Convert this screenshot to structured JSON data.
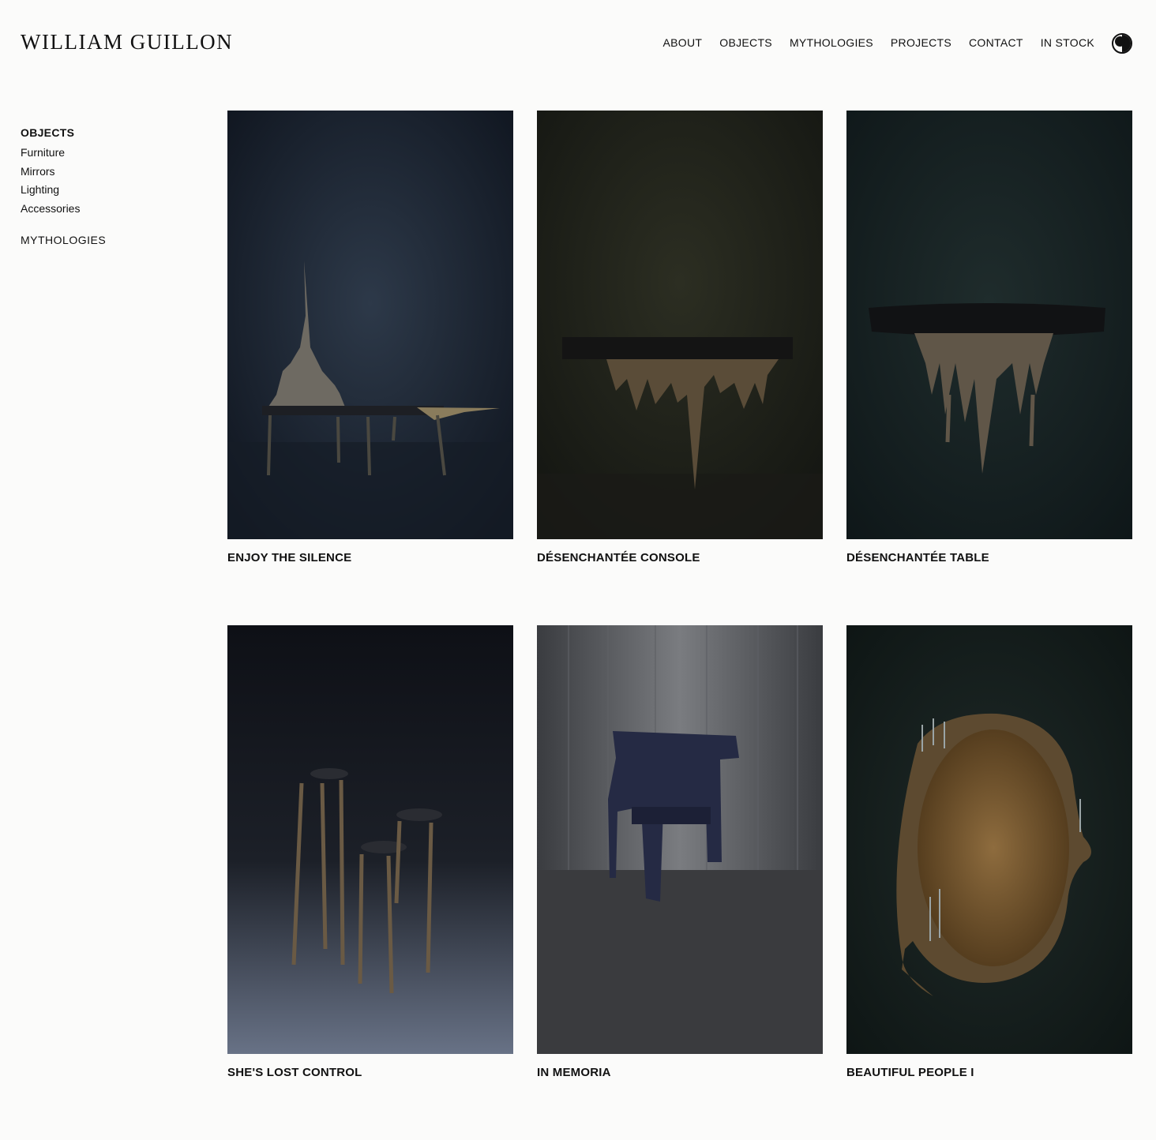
{
  "brand": {
    "name": "WILLIAM GUILLON"
  },
  "nav": [
    "ABOUT",
    "OBJECTS",
    "MYTHOLOGIES",
    "PROJECTS",
    "CONTACT",
    "IN STOCK"
  ],
  "sidebar": {
    "heading": "OBJECTS",
    "items": [
      "Furniture",
      "Mirrors",
      "Lighting",
      "Accessories"
    ],
    "secondary": "MYTHOLOGIES"
  },
  "products": [
    {
      "title": "ENJOY THE SILENCE"
    },
    {
      "title": "DÉSENCHANTÉE CONSOLE"
    },
    {
      "title": "DÉSENCHANTÉE TABLE"
    },
    {
      "title": "SHE'S LOST CONTROL"
    },
    {
      "title": "IN MEMORIA"
    },
    {
      "title": "BEAUTIFUL PEOPLE I"
    }
  ],
  "icons": {
    "theme_toggle": "half-moon-icon"
  },
  "colors": {
    "background": "#fbfbfa",
    "text": "#111111"
  }
}
